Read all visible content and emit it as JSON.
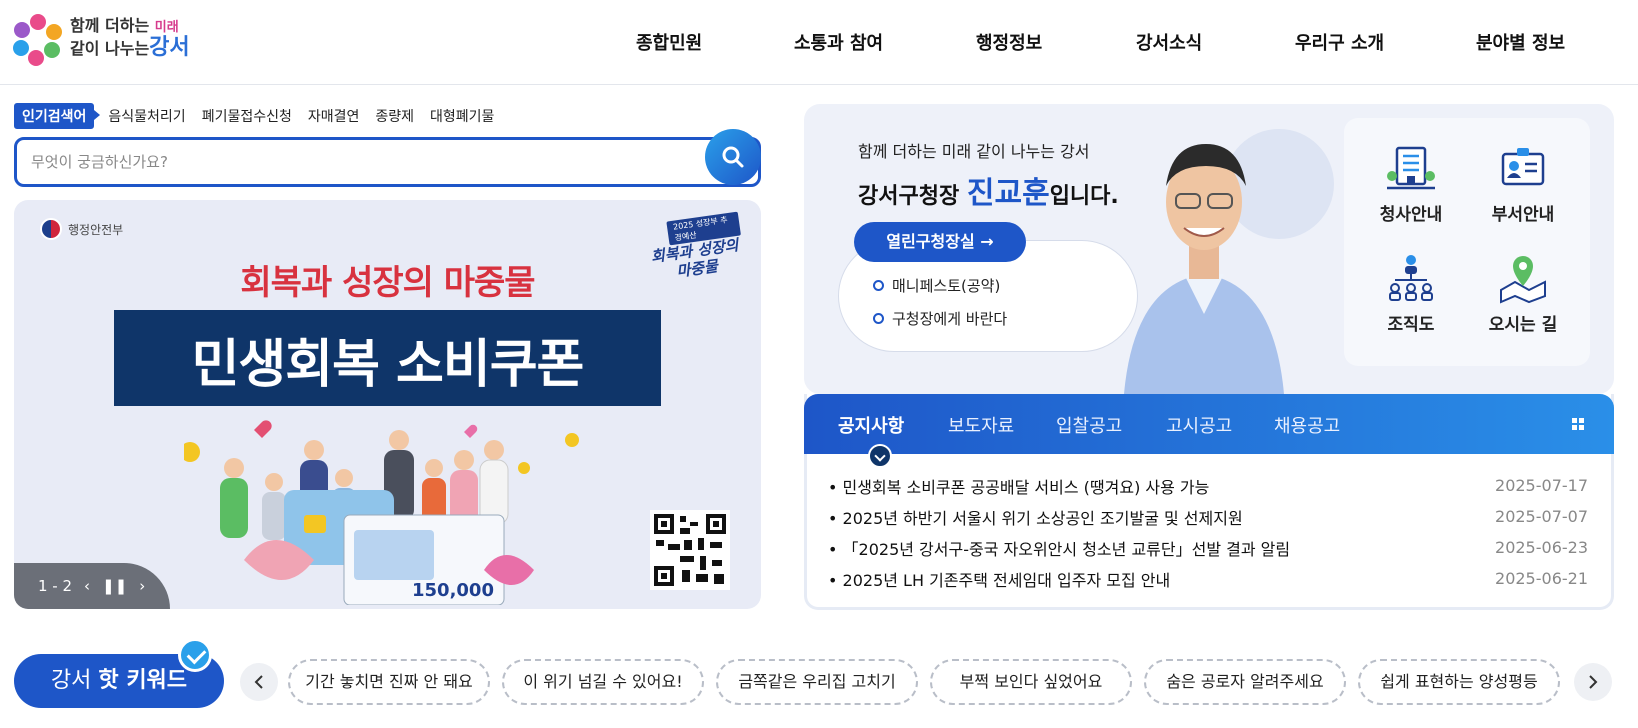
{
  "header": {
    "logo_line1": "함께 더하는",
    "logo_line1_accent": "미래",
    "logo_line2": "같이 나누는",
    "logo_line2_accent": "강서",
    "nav": [
      "종합민원",
      "소통과 참여",
      "행정정보",
      "강서소식",
      "우리구 소개",
      "분야별 정보"
    ]
  },
  "search": {
    "popular_label": "인기검색어",
    "popular_keywords": [
      "음식물처리기",
      "폐기물접수신청",
      "자매결연",
      "종량제",
      "대형폐기물"
    ],
    "placeholder": "무엇이 궁금하신가요?",
    "button_icon": "search-icon"
  },
  "banner": {
    "org": "행정안전부",
    "stamp_top": "2025 성장부 추경예산",
    "stamp_title": "회복과 성장의 마중물",
    "subtitle": "회복과 성장의 마중물",
    "title": "민생회복 소비쿠폰",
    "coupon_amount": "150,000",
    "pager": "1 - 2"
  },
  "mayor": {
    "slogan": "함께 더하는 미래 같이 나누는 강서",
    "title_prefix": "강서구청장",
    "name": "진교훈",
    "title_suffix": "입니다.",
    "office_button": "열린구청장실 →",
    "links": [
      "매니페스토(공약)",
      "구청장에게 바란다"
    ],
    "quick": [
      {
        "label": "청사안내",
        "icon": "building-icon"
      },
      {
        "label": "부서안내",
        "icon": "id-card-icon"
      },
      {
        "label": "조직도",
        "icon": "org-chart-icon"
      },
      {
        "label": "오시는 길",
        "icon": "map-pin-icon"
      }
    ]
  },
  "notices": {
    "tabs": [
      "공지사항",
      "보도자료",
      "입찰공고",
      "고시공고",
      "채용공고"
    ],
    "active_tab": "공지사항",
    "items": [
      {
        "title": "민생회복 소비쿠폰 공공배달 서비스 (땡겨요) 사용 가능",
        "date": "2025-07-17"
      },
      {
        "title": "2025년 하반기 서울시 위기 소상공인 조기발굴 및 선제지원",
        "date": "2025-07-07"
      },
      {
        "title": "「2025년 강서구-중국 자오위안시 청소년 교류단」선발 결과 알림",
        "date": "2025-06-23"
      },
      {
        "title": "2025년 LH 기존주택 전세임대 입주자 모집 안내",
        "date": "2025-06-21"
      }
    ]
  },
  "hot_keywords": {
    "label_prefix": "강서",
    "label_bold": "핫 키워드",
    "chips": [
      "기간 놓치면 진짜 안 돼요",
      "이 위기 넘길 수 있어요!",
      "금쪽같은 우리집 고치기",
      "부쩍 보인다 싶었어요",
      "숨은 공로자 알려주세요",
      "쉽게 표현하는 양성평등"
    ]
  },
  "colors": {
    "primary": "#1e56c8",
    "accent": "#2a8fe8",
    "banner_red": "#d8323f",
    "banner_navy": "#0f3569"
  }
}
